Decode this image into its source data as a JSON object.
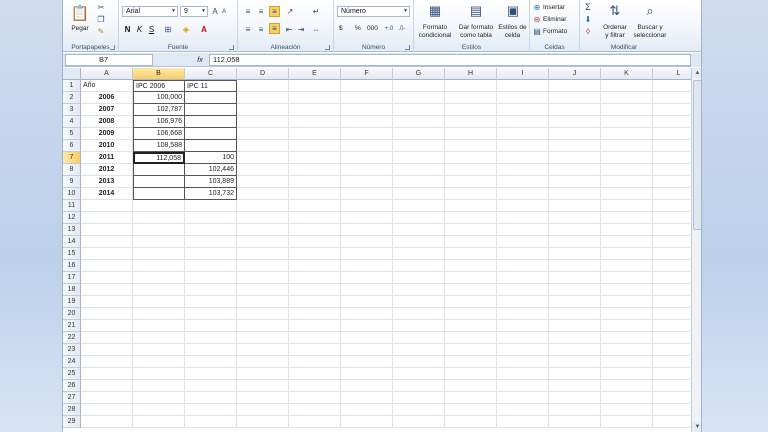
{
  "ribbon": {
    "portapapeles": {
      "label": "Portapapeles",
      "paste": "Pegar"
    },
    "fuente": {
      "label": "Fuente",
      "font_name": "Arial",
      "font_size": "9"
    },
    "alineacion": {
      "label": "Alineación"
    },
    "numero": {
      "label": "Número",
      "format": "Número",
      "currency": "$",
      "percent": "%",
      "thousands": "000"
    },
    "estilos": {
      "label": "Estilos",
      "cond_format": [
        "Formato",
        "condicional"
      ],
      "table_format": [
        "Dar formato",
        "como tabla"
      ],
      "cell_styles": [
        "Estilos de",
        "celda"
      ]
    },
    "celdas": {
      "label": "Celdas",
      "insert": "Insertar",
      "delete": "Eliminar",
      "format": "Formato"
    },
    "modificar": {
      "label": "Modificar",
      "sort": [
        "Ordenar",
        "y filtrar"
      ],
      "find": [
        "Buscar y",
        "seleccionar"
      ]
    }
  },
  "formula_bar": {
    "name_box": "B7",
    "fx": "fx",
    "content": "112,058"
  },
  "columns": [
    "A",
    "B",
    "C",
    "D",
    "E",
    "F",
    "G",
    "H",
    "I",
    "J",
    "K",
    "L"
  ],
  "selected_column": "B",
  "selected_row": 7,
  "rows": [
    "1",
    "2",
    "3",
    "4",
    "5",
    "6",
    "7",
    "8",
    "9",
    "10",
    "11",
    "12",
    "13",
    "14",
    "15",
    "16",
    "17",
    "18",
    "19",
    "20",
    "21",
    "22",
    "23",
    "24",
    "25",
    "26",
    "27",
    "28",
    "29"
  ],
  "cells": {
    "A1": "Año",
    "B1": "IPC  2006",
    "C1": "IPC 11",
    "A2": "2006",
    "B2": "100,000",
    "A3": "2007",
    "B3": "102,787",
    "A4": "2008",
    "B4": "106,976",
    "A5": "2009",
    "B5": "106,668",
    "A6": "2010",
    "B6": "108,588",
    "A7": "2011",
    "B7": "112,058",
    "C7": "100",
    "A8": "2012",
    "C8": "102,446",
    "A9": "2013",
    "C9": "103,889",
    "A10": "2014",
    "C10": "103,732"
  }
}
